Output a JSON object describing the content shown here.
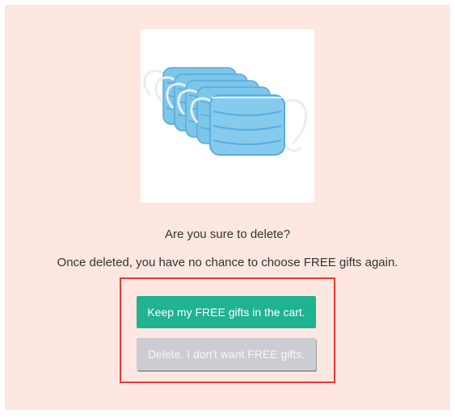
{
  "dialog": {
    "product_image": {
      "icon": "surgical-masks-stack",
      "colors": {
        "mask": "#7cc6ea",
        "mask_dark": "#58ade0",
        "strap": "#eef5fa"
      }
    },
    "question": "Are you sure to delete?",
    "warning": "Once deleted, you have no chance to choose FREE gifts again.",
    "keep_button_label": "Keep my FREE gifts in the cart.",
    "delete_button_label": "Delete. I don't want FREE gifts.",
    "colors": {
      "background": "#fde7e0",
      "keep_button": "#1fb38f",
      "delete_button": "#cbcdd3",
      "highlight_frame": "#e53935"
    }
  }
}
